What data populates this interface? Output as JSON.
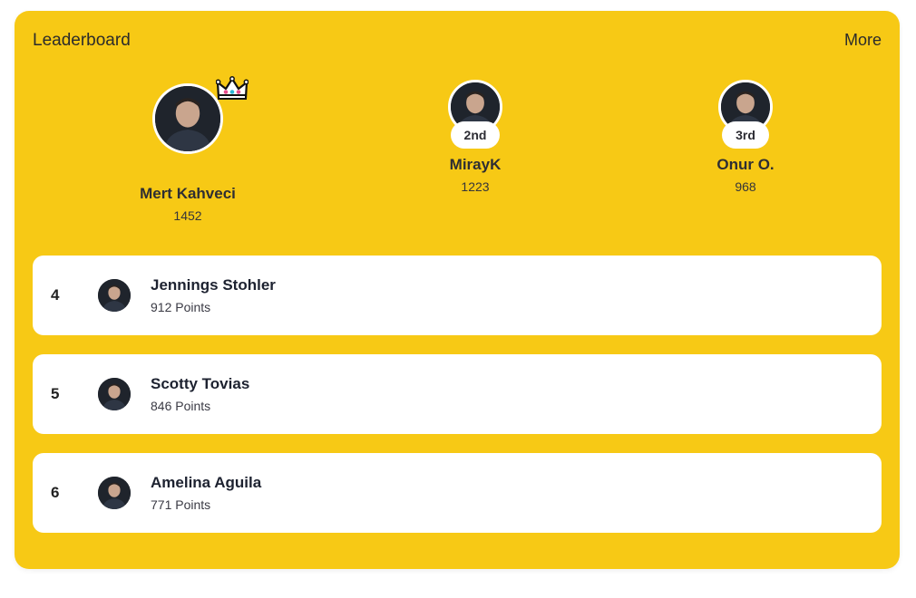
{
  "header": {
    "title": "Leaderboard",
    "more_label": "More"
  },
  "podium": [
    {
      "name": "Mert Kahveci",
      "score": "1452",
      "rank_label": ""
    },
    {
      "name": "MirayK",
      "score": "1223",
      "rank_label": "2nd"
    },
    {
      "name": "Onur O.",
      "score": "968",
      "rank_label": "3rd"
    }
  ],
  "rows": [
    {
      "rank": "4",
      "name": "Jennings Stohler",
      "points": "912 Points"
    },
    {
      "rank": "5",
      "name": "Scotty Tovias",
      "points": "846 Points"
    },
    {
      "rank": "6",
      "name": "Amelina Aguila",
      "points": "771 Points"
    }
  ],
  "colors": {
    "card_bg": "#f7c915",
    "row_bg": "#ffffff",
    "text": "#1f2430"
  },
  "icons": {
    "crown": "crown-icon",
    "more": "more-link"
  }
}
